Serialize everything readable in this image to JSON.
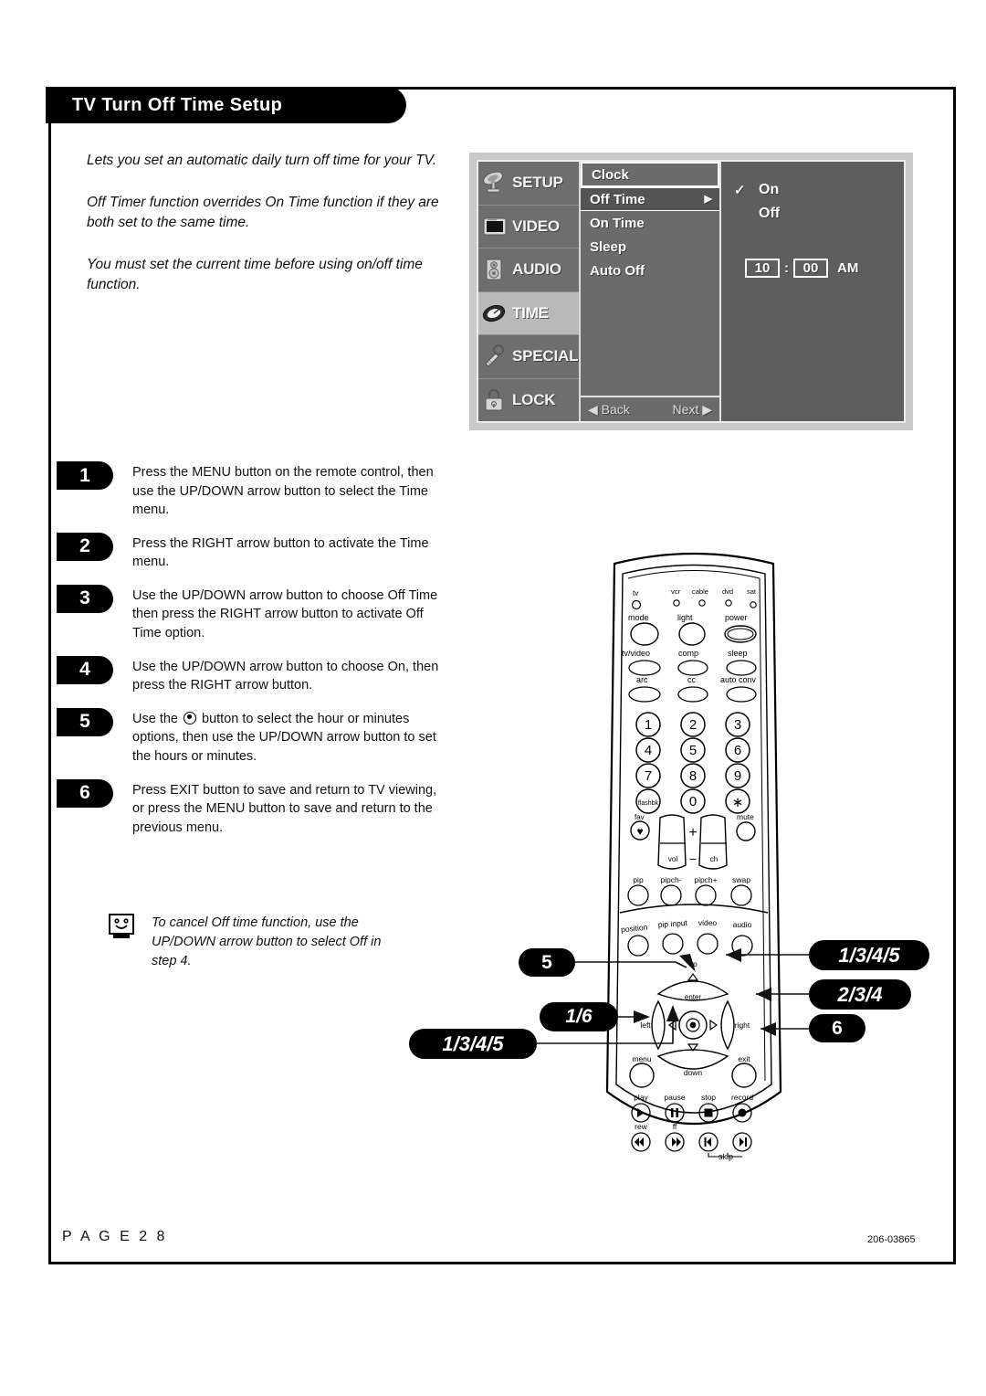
{
  "header": {
    "title": "TV Turn Off Time Setup"
  },
  "intro": {
    "p1": "Lets you set an automatic daily turn off time for your TV.",
    "p2": "Off Timer function overrides On Time function if they are both set to the same time.",
    "p3": "You must set the current time before using on/off time function."
  },
  "osd": {
    "categories": [
      {
        "label": "SETUP",
        "icon": "satellite-dish-icon",
        "active": false
      },
      {
        "label": "VIDEO",
        "icon": "tv-screen-icon",
        "active": false
      },
      {
        "label": "AUDIO",
        "icon": "speaker-icon",
        "active": false
      },
      {
        "label": "TIME",
        "icon": "clock-icon",
        "active": true
      },
      {
        "label": "SPECIAL",
        "icon": "key-icon",
        "active": false
      },
      {
        "label": "LOCK",
        "icon": "padlock-icon",
        "active": false
      }
    ],
    "items": [
      {
        "label": "Clock",
        "state": "boxed",
        "arrow": ""
      },
      {
        "label": "Off Time",
        "state": "selected",
        "arrow": "▶"
      },
      {
        "label": "On Time",
        "state": "normal",
        "arrow": ""
      },
      {
        "label": "Sleep",
        "state": "normal",
        "arrow": ""
      },
      {
        "label": "Auto Off",
        "state": "normal",
        "arrow": ""
      }
    ],
    "nav": {
      "back": "◀ Back",
      "next": "Next ▶"
    },
    "options": {
      "on_label": "On",
      "on_check": "✓",
      "off_label": "Off",
      "hour": "10",
      "colon": ":",
      "minute": "00",
      "ampm": "AM"
    },
    "colors": {
      "panel_bg": "#c9c9c9",
      "sidebar_bg": "#6e6e6e",
      "active_bg": "#b9b9b9",
      "list_bg": "#6b6b6b",
      "selected_bg": "#545454",
      "options_bg": "#5e5e5e"
    }
  },
  "steps": [
    {
      "number": "1",
      "text": "Press the MENU button on the remote control, then use the UP/DOWN arrow button to select the Time menu."
    },
    {
      "number": "2",
      "text": "Press the RIGHT arrow button to activate the Time menu."
    },
    {
      "number": "3",
      "text": "Use the UP/DOWN arrow button to choose Off Time then press the RIGHT arrow button to activate Off Time option."
    },
    {
      "number": "4",
      "text": "Use the UP/DOWN arrow button to choose On, then press the RIGHT arrow button."
    },
    {
      "number": "5",
      "text_before": "Use the ",
      "text_after": " button to select the hour or minutes options, then use the UP/DOWN arrow button to set the hours or minutes.",
      "glyph": "enter-button-icon"
    },
    {
      "number": "6",
      "text": "Press EXIT button to save and return to TV viewing, or press the MENU button to save and return to the previous menu."
    }
  ],
  "note": {
    "icon": "smiley-tv-icon",
    "text": "To cancel Off time function, use the UP/DOWN arrow button to select Off in step 4."
  },
  "remote": {
    "device_labels": [
      "tv",
      "vcr",
      "cable",
      "dvd",
      "sat"
    ],
    "row_mode": [
      "mode",
      "light",
      "power"
    ],
    "row_tvvideo": [
      "tv/video",
      "comp",
      "sleep"
    ],
    "row_arc": [
      "arc",
      "cc",
      "auto conv"
    ],
    "keypad": [
      "1",
      "2",
      "3",
      "4",
      "5",
      "6",
      "7",
      "8",
      "9",
      "flashbk",
      "0",
      "∗"
    ],
    "fav_label": "fav",
    "mute_label": "mute",
    "vol_label": "vol",
    "ch_label": "ch",
    "plus_label": "+",
    "minus_label": "−",
    "row_pip": [
      "pip",
      "pipch-",
      "pipch+",
      "swap"
    ],
    "row_position": [
      "position",
      "pip input",
      "video",
      "audio"
    ],
    "nav_up": "up",
    "nav_down": "down",
    "nav_left": "left",
    "nav_right": "right",
    "nav_enter": "enter",
    "menu_label": "menu",
    "exit_label": "exit",
    "transport1": [
      "play",
      "pause",
      "stop",
      "record"
    ],
    "transport2": [
      "rew",
      "ff"
    ],
    "skip_label": "skip"
  },
  "callouts": {
    "up_button": "1/3/4/5",
    "right_button": "2/3/4",
    "exit_button": "6",
    "enter_button": "5",
    "menu_button": "1/6",
    "down_button": "1/3/4/5"
  },
  "footer": {
    "page": "P A G E   2 8",
    "code": "206-03865"
  }
}
